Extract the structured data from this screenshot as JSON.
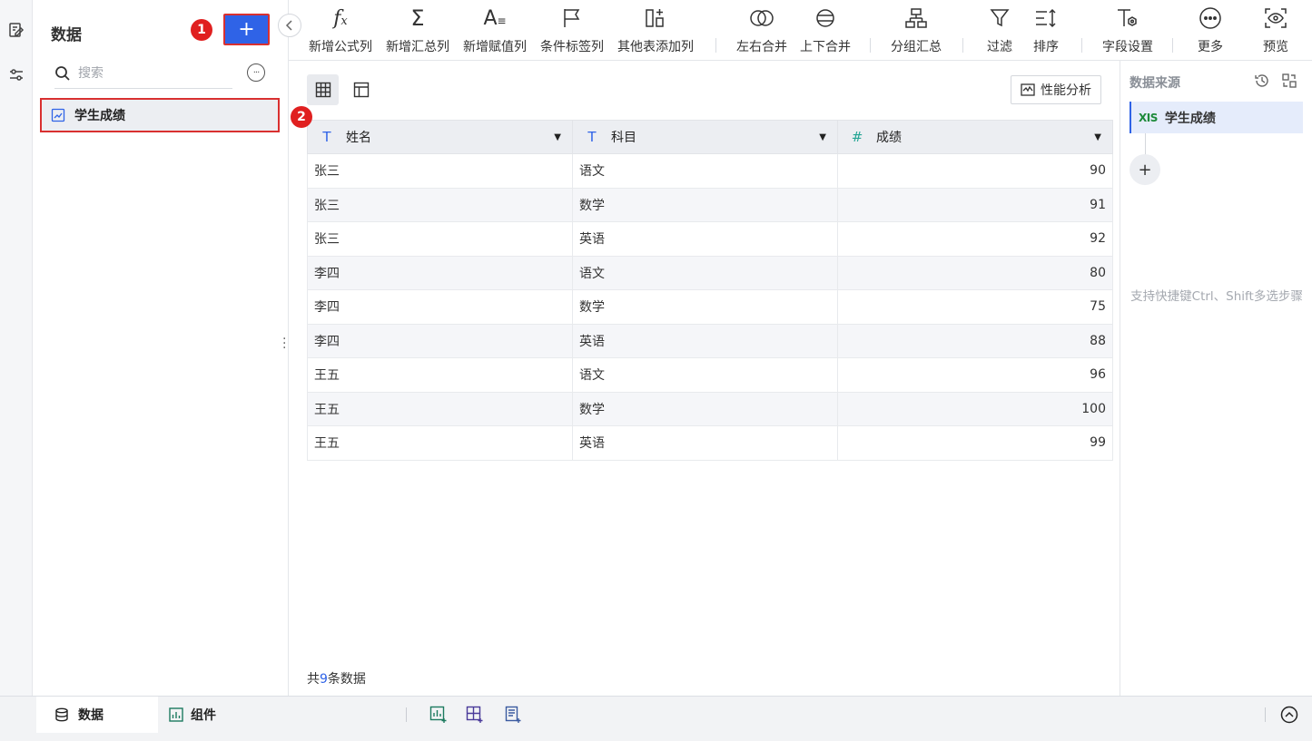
{
  "left_panel": {
    "title": "数据",
    "add_label": "+",
    "search_placeholder": "搜索",
    "more_label": "···",
    "dataset_name": "学生成绩",
    "badges": [
      "1",
      "2"
    ]
  },
  "toolbar": {
    "items": [
      {
        "label": "新增公式列",
        "icon": "formula-icon"
      },
      {
        "label": "新增汇总列",
        "icon": "sigma-icon"
      },
      {
        "label": "新增赋值列",
        "icon": "assign-icon"
      },
      {
        "label": "条件标签列",
        "icon": "flag-icon"
      },
      {
        "label": "其他表添加列",
        "icon": "add-column-icon"
      },
      {
        "label": "左右合并",
        "icon": "merge-horizontal-icon"
      },
      {
        "label": "上下合并",
        "icon": "merge-vertical-icon"
      },
      {
        "label": "分组汇总",
        "icon": "group-icon"
      },
      {
        "label": "过滤",
        "icon": "filter-icon"
      },
      {
        "label": "排序",
        "icon": "sort-icon"
      },
      {
        "label": "字段设置",
        "icon": "field-settings-icon"
      },
      {
        "label": "更多",
        "icon": "more-icon"
      },
      {
        "label": "预览",
        "icon": "preview-icon"
      }
    ]
  },
  "main": {
    "perf_label": "性能分析",
    "columns": [
      {
        "name": "姓名",
        "type": "T"
      },
      {
        "name": "科目",
        "type": "T"
      },
      {
        "name": "成绩",
        "type": "#"
      }
    ],
    "rows": [
      [
        "张三",
        "语文",
        "90"
      ],
      [
        "张三",
        "数学",
        "91"
      ],
      [
        "张三",
        "英语",
        "92"
      ],
      [
        "李四",
        "语文",
        "80"
      ],
      [
        "李四",
        "数学",
        "75"
      ],
      [
        "李四",
        "英语",
        "88"
      ],
      [
        "王五",
        "语文",
        "96"
      ],
      [
        "王五",
        "数学",
        "100"
      ],
      [
        "王五",
        "英语",
        "99"
      ]
    ],
    "count_prefix": "共",
    "count": "9",
    "count_suffix": "条数据"
  },
  "right_panel": {
    "title": "数据来源",
    "step_icon_text": "XIS",
    "step_label": "学生成绩",
    "add_label": "+",
    "hint": "支持快捷键Ctrl、Shift多选步骤"
  },
  "bottom": {
    "tabs": [
      {
        "label": "数据",
        "icon": "database-icon"
      },
      {
        "label": "组件",
        "icon": "chart-icon"
      }
    ]
  },
  "colors": {
    "accent": "#2f63e7",
    "highlight_border": "#d93030",
    "badge": "#e02020",
    "number_type": "#24a594"
  }
}
